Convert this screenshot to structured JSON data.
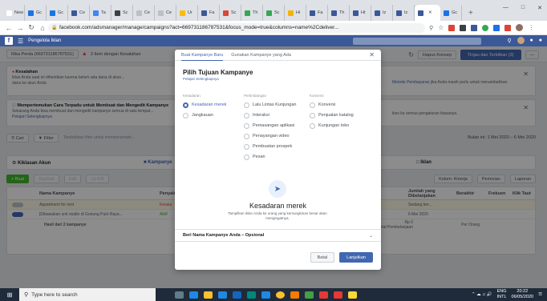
{
  "browser": {
    "tabs": [
      {
        "label": "New Ta",
        "color": "#fff"
      },
      {
        "label": "Gc",
        "color": "#1a73e8"
      },
      {
        "label": "Gc",
        "color": "#1a73e8"
      },
      {
        "label": "Ce",
        "color": "#3b5998"
      },
      {
        "label": "Ta",
        "color": "#4285f4"
      },
      {
        "label": "Sc",
        "color": "#3c4043"
      },
      {
        "label": "Ce",
        "color": "#bdc1c6"
      },
      {
        "label": "Ce",
        "color": "#bdc1c6"
      },
      {
        "label": "Ur",
        "color": "#fbbc05"
      },
      {
        "label": "Fa",
        "color": "#3b5998"
      },
      {
        "label": "Sc",
        "color": "#db4437"
      },
      {
        "label": "Th",
        "color": "#34a853"
      },
      {
        "label": "Sc",
        "color": "#34a853"
      },
      {
        "label": "Hi",
        "color": "#f4b400"
      },
      {
        "label": "Fa",
        "color": "#3b5998"
      },
      {
        "label": "Th",
        "color": "#3b5998"
      },
      {
        "label": "Ht",
        "color": "#3b5998"
      },
      {
        "label": "Iz",
        "color": "#3b5998"
      },
      {
        "label": "Iz",
        "color": "#3b5998"
      },
      {
        "label": "",
        "color": "#3b5998",
        "active": true
      },
      {
        "label": "Gc",
        "color": "#1a73e8"
      }
    ],
    "new_tab": "+",
    "url": "facebook.com/adsmanager/manage/campaigns?act=669731186787531&focus_mode=true&columns=name%2Cdeliver..."
  },
  "fb": {
    "title": "Pengelola Iklan"
  },
  "toolbar": {
    "account": "Rika Perda (669731186787531)",
    "warning": "3 Item dengan Kesalahan",
    "discard": "Hapus Konsep",
    "publish": "Tinjau dan Terbitkan (3)"
  },
  "notices": [
    {
      "title": "Kesalahan",
      "body": "Iklan Anda saat ini dihentikan karena belum ada dana di akun...",
      "body2": "dana ke akun Anda",
      "link": "Metode Pembayaran",
      "right": "jika Anda masih perlu untuk menambahkan"
    },
    {
      "title": "Mempertemukan Cara Terpadu untuk Membuat dan Mengedit Kampanye",
      "body": "Sekarang Anda bisa membuat dan mengedit kampanye semua di satu tempat...",
      "link": "Pelajari Selengkapnya",
      "right": "ikes ke semua pengaturan biasanya."
    }
  ],
  "filter": {
    "search": "Cari",
    "filter": "Filter",
    "placeholder": "Tambahkan filter untuk mempersempit...",
    "daterange": "Bulan ini: 1 Mei 2020 – 6 Mei 2020"
  },
  "level_tabs": {
    "accounts": "Kiklasan Akun",
    "campaigns": "Kampanye",
    "ads": "Iklan"
  },
  "actions": {
    "create": "+ Buat",
    "duplicate": "Duplikat",
    "edit": "Edit",
    "ab": "Uji A/B",
    "columns": "Kolom: Kinerja",
    "breakdown": "Perincian",
    "reports": "Laporan"
  },
  "table": {
    "headers": [
      "Nama Kampanye",
      "Penyaluran",
      "Jumlah yang Dibelanjakan",
      "Berakhir",
      "Frekuen",
      "Klik Taut"
    ],
    "rows": [
      [
        "Appartment for rent",
        "Kesala",
        "Sedang ber..."
      ],
      [
        "[Dibawakan unit studio di Gunung Putri Raya...",
        "Aktif",
        "6 Mei 2020"
      ]
    ],
    "summary": "Hasil dari 2 kampanye",
    "total_spend": "Rp 0",
    "total_label": "Total Pembelanjaan",
    "per": "Per Orang"
  },
  "modal": {
    "tab_new": "Buat Kampanye Baru",
    "tab_existing": "Gunakan Kampanye yang Ada",
    "heading": "Pilih Tujuan Kampanye",
    "learn": "Pelajari Selengkapnya",
    "col1_title": "Kesadaran",
    "col2_title": "Pertimbangan",
    "col3_title": "Konversi",
    "col1": [
      "Kesadaran merek",
      "Jangkauan"
    ],
    "col2": [
      "Lalu Lintas Kunjungan",
      "Interaksi",
      "Pemasangan aplikasi",
      "Penayangan video",
      "Pembuatan prospek",
      "Pesan"
    ],
    "col3": [
      "Konversi",
      "Penjualan katalog",
      "Kunjungan toko"
    ],
    "selected_title": "Kesadaran merek",
    "selected_desc": "Tampilkan iklan Anda ke orang yang kemungkinan besar akan mengingatnya.",
    "name_label": "Beri Nama Kampanye Anda – Opsional",
    "cancel": "Batal",
    "continue": "Lanjutkan"
  },
  "taskbar": {
    "search_placeholder": "Type here to search",
    "lang": "ENG",
    "region": "INTL",
    "time": "20:22",
    "date": "06/05/2020"
  },
  "colors": {
    "fb_blue": "#3b5998",
    "button_blue": "#4267b2",
    "green": "#42b72a",
    "error_red": "#fa3e3e"
  }
}
